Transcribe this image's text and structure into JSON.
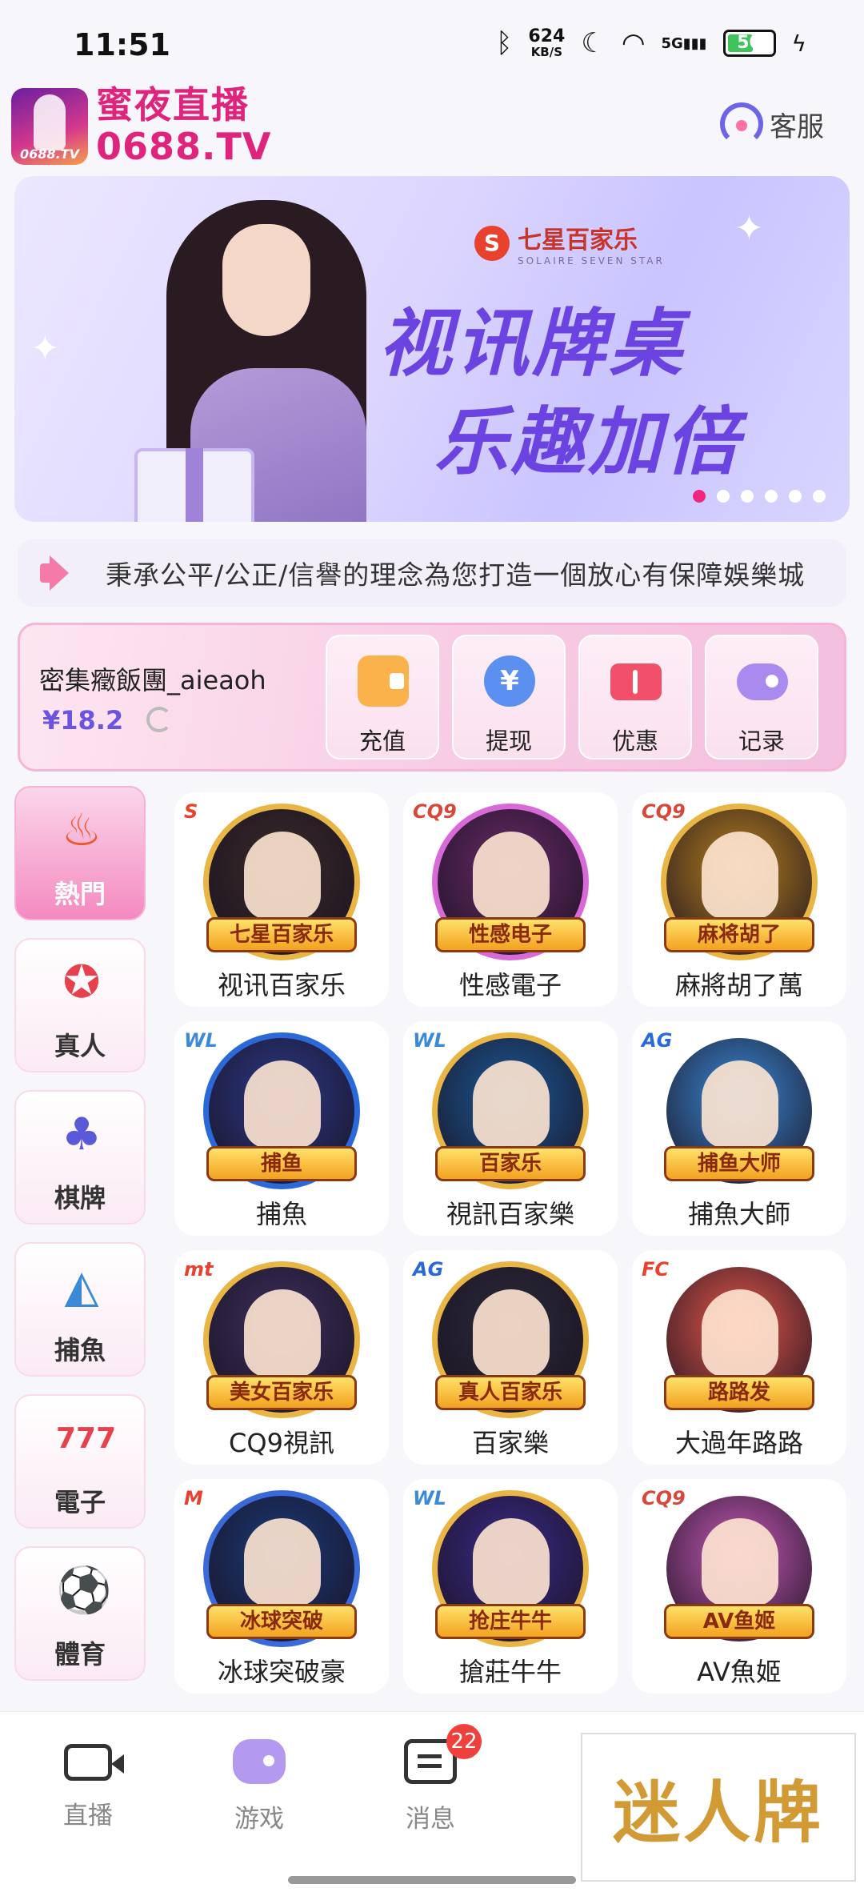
{
  "status_bar": {
    "time": "11:51",
    "net_speed_value": "624",
    "net_speed_unit": "KB/S",
    "signal": "5G",
    "battery": "50"
  },
  "header": {
    "brand_name": "蜜夜直播",
    "brand_domain": "0688.TV",
    "logo_text": "0688.TV",
    "service_label": "客服"
  },
  "banner": {
    "brand_cn": "七星百家乐",
    "brand_en": "SOLAIRE SEVEN STAR",
    "headline_1": "视讯牌桌",
    "headline_2": "乐趣加倍",
    "dot_count": 6,
    "active_dot": 0
  },
  "notice": {
    "text": "秉承公平/公正/信譽的理念為您打造一個放心有保障娛樂城"
  },
  "account": {
    "username": "密集癥飯團_aieaoh",
    "balance": "¥18.2",
    "actions": [
      {
        "label": "充值",
        "icon": "wallet-icon"
      },
      {
        "label": "提现",
        "icon": "yen-icon"
      },
      {
        "label": "优惠",
        "icon": "coupon-icon"
      },
      {
        "label": "记录",
        "icon": "gamepad-icon"
      }
    ]
  },
  "categories": [
    {
      "label": "熱門",
      "icon": "fire-icon",
      "active": true
    },
    {
      "label": "真人",
      "icon": "poker-chip-icon",
      "active": false
    },
    {
      "label": "棋牌",
      "icon": "playing-cards-icon",
      "active": false
    },
    {
      "label": "捕魚",
      "icon": "shark-icon",
      "active": false
    },
    {
      "label": "電子",
      "icon": "slot-777-icon",
      "active": false
    },
    {
      "label": "體育",
      "icon": "soccer-ball-icon",
      "active": false
    }
  ],
  "games": [
    {
      "label": "视讯百家乐",
      "badge": "S",
      "art_text": "七星百家乐",
      "ring": "#e9b645",
      "bg": "#3a2a2a"
    },
    {
      "label": "性感電子",
      "badge": "CQ9",
      "art_text": "性感电子",
      "ring": "#d86ad8",
      "bg": "#6a2a6a"
    },
    {
      "label": "麻將胡了萬",
      "badge": "CQ9",
      "art_text": "麻将胡了",
      "ring": "#e9b645",
      "bg": "#b8801e"
    },
    {
      "label": "捕魚",
      "badge": "WL",
      "art_text": "捕鱼",
      "ring": "#2a6ad8",
      "bg": "#2a3a8a"
    },
    {
      "label": "視訊百家樂",
      "badge": "WL",
      "art_text": "百家乐",
      "ring": "#e9b645",
      "bg": "#1a5a9a"
    },
    {
      "label": "捕魚大師",
      "badge": "AG",
      "art_text": "捕鱼大师",
      "ring": "#ffffff",
      "bg": "#3a8ad8"
    },
    {
      "label": "CQ9視訊",
      "badge": "mt",
      "art_text": "美女百家乐",
      "ring": "#e9b645",
      "bg": "#3a3060"
    },
    {
      "label": "百家樂",
      "badge": "AG",
      "art_text": "真人百家乐",
      "ring": "#e9b645",
      "bg": "#2a2a3a"
    },
    {
      "label": "大過年路路",
      "badge": "FC",
      "art_text": "路路发",
      "ring": "#ffffff",
      "bg": "#e8584a"
    },
    {
      "label": "冰球突破豪",
      "badge": "M",
      "art_text": "冰球突破",
      "ring": "#3a6ad8",
      "bg": "#1a3a7a"
    },
    {
      "label": "搶莊牛牛",
      "badge": "WL",
      "art_text": "抢庄牛牛",
      "ring": "#e9b645",
      "bg": "#3a2a8a"
    },
    {
      "label": "AV魚姬",
      "badge": "CQ9",
      "art_text": "AV鱼姬",
      "ring": "#ffffff",
      "bg": "#c85ab8"
    }
  ],
  "bottom_nav": {
    "tabs": [
      {
        "label": "直播",
        "icon": "camera-icon"
      },
      {
        "label": "游戏",
        "icon": "gamepad-icon"
      },
      {
        "label": "消息",
        "icon": "message-icon"
      }
    ],
    "message_badge": "22",
    "promo_text": "迷人牌"
  },
  "colors": {
    "brand_pink": "#e0247d",
    "accent_purple": "#6b55de"
  }
}
